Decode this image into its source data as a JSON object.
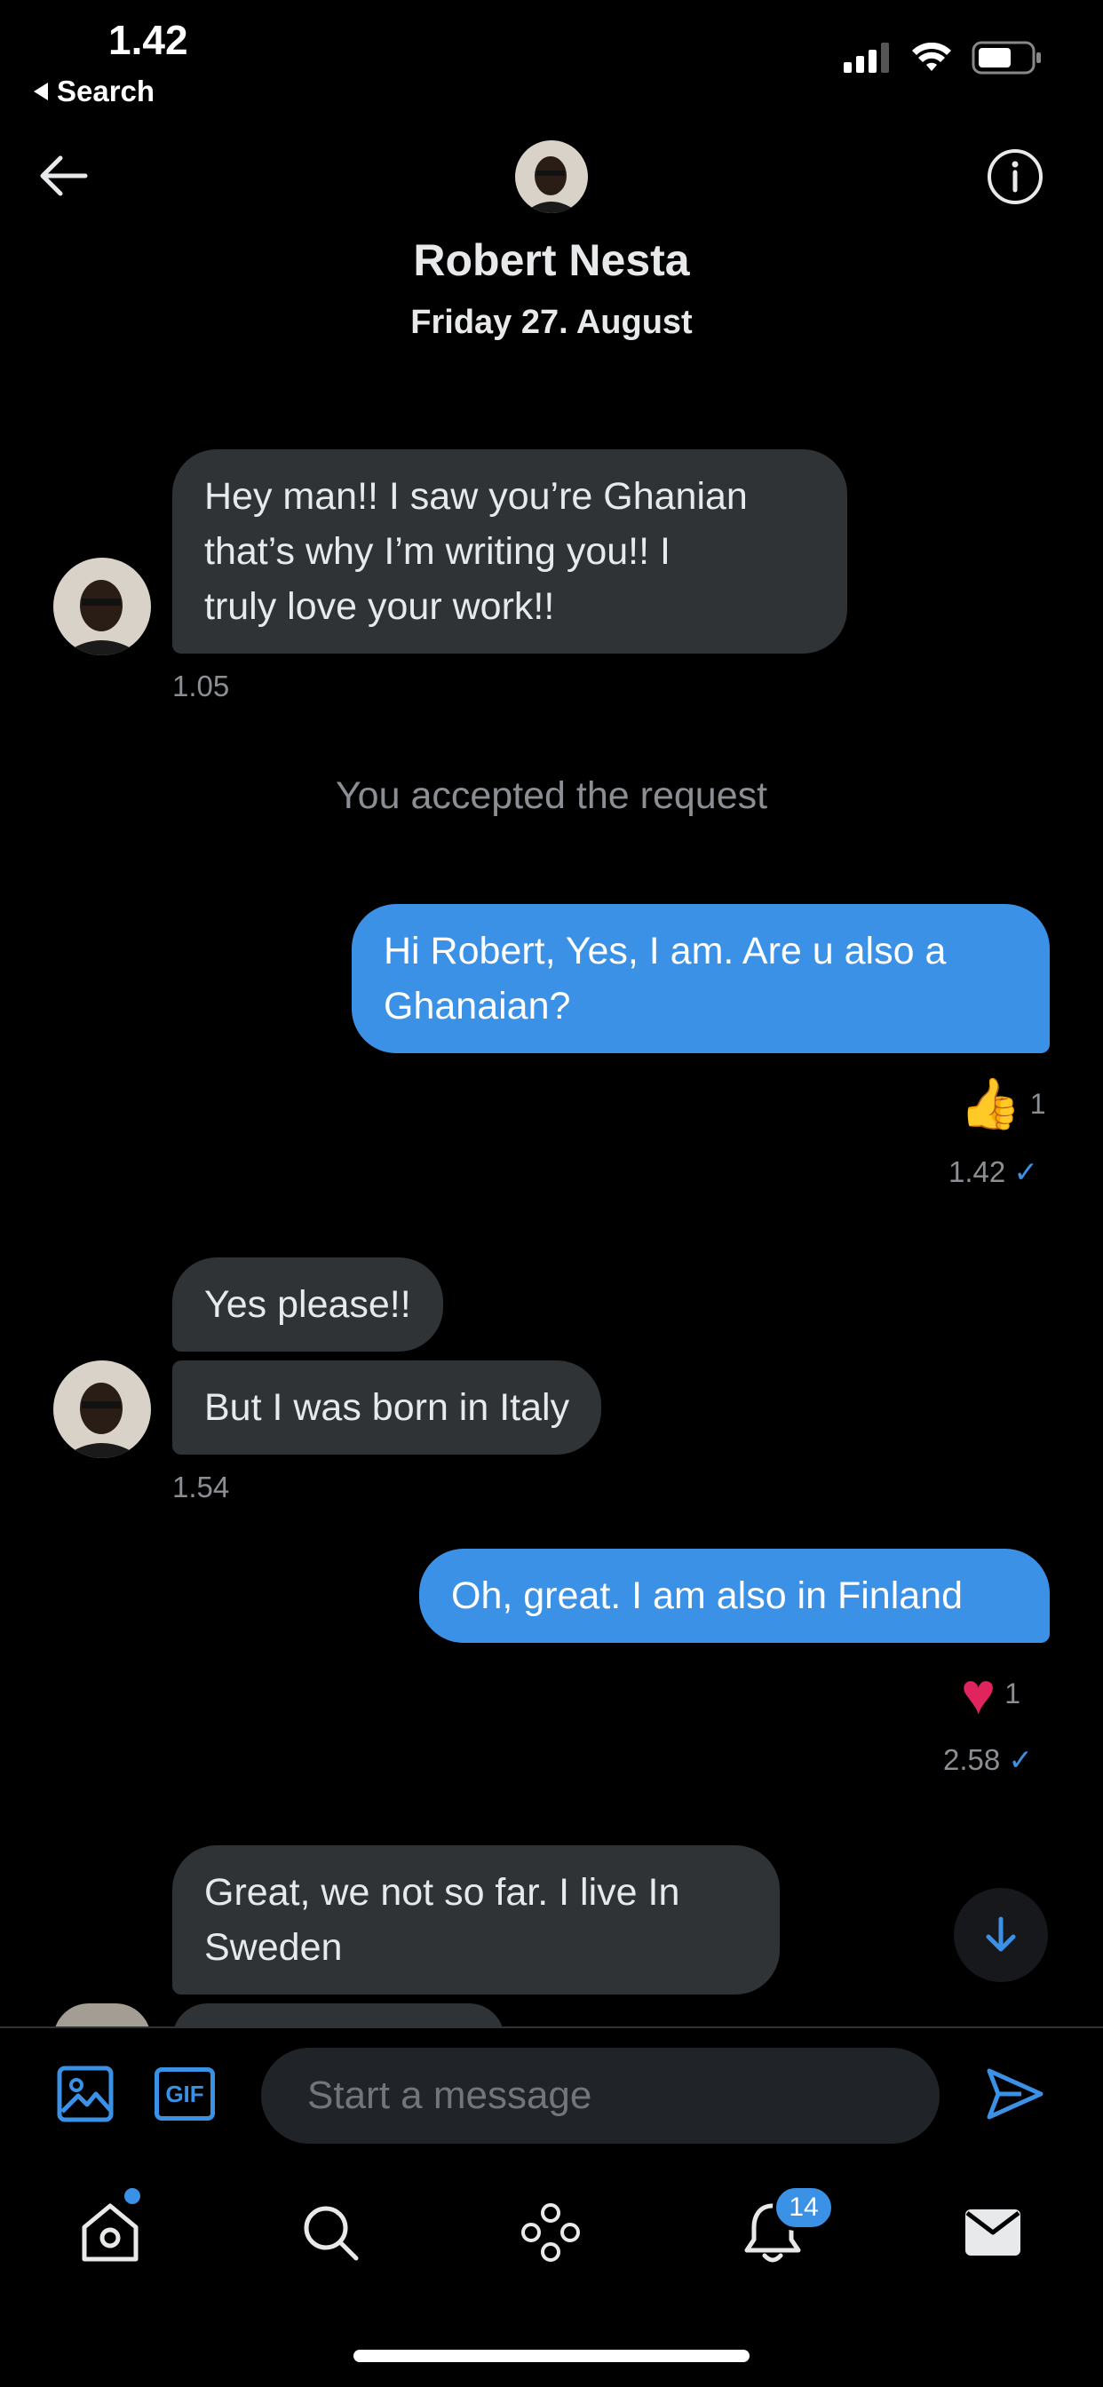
{
  "status_bar": {
    "time": "1.42",
    "back_label": "Search",
    "icons": [
      "cellular-signal-icon",
      "wifi-icon",
      "battery-icon"
    ]
  },
  "header": {
    "name": "Robert Nesta",
    "date": "Friday 27. August",
    "icons": [
      "back-arrow-icon",
      "info-icon"
    ]
  },
  "messages": [
    {
      "direction": "in",
      "lines": [
        "Hey man!! I saw you’re Ghanian",
        "that’s why I’m writing you!! I",
        "truly love your work!!"
      ],
      "time": "1.05"
    },
    {
      "direction": "out",
      "lines": [
        "Hi Robert, Yes, I am. Are u also a",
        "Ghanaian?"
      ],
      "reaction": "👍",
      "reaction_count": "1",
      "time": "1.42",
      "read": "✓"
    },
    {
      "direction": "in",
      "lines": [
        "Yes please!!"
      ]
    },
    {
      "direction": "in",
      "lines": [
        "But I was born in Italy"
      ],
      "time": "1.54"
    },
    {
      "direction": "out",
      "lines": [
        "Oh, great. I am also in Finland"
      ],
      "reaction": "♥",
      "reaction_count": "1",
      "time": "2.58",
      "read": "✓"
    },
    {
      "direction": "in",
      "lines": [
        "Great, we not so far. I live In",
        "Sweden"
      ]
    }
  ],
  "system_note": "You accepted the request",
  "composer": {
    "placeholder": "Start a message",
    "gif_label": "GIF"
  },
  "nav": {
    "items": [
      "home-icon",
      "search-icon",
      "spaces-icon",
      "notifications-icon",
      "messages-icon"
    ],
    "notifications_badge": "14"
  },
  "colors": {
    "accent": "#3a91e6",
    "incoming_bubble": "#2f3336",
    "background": "#000000"
  }
}
